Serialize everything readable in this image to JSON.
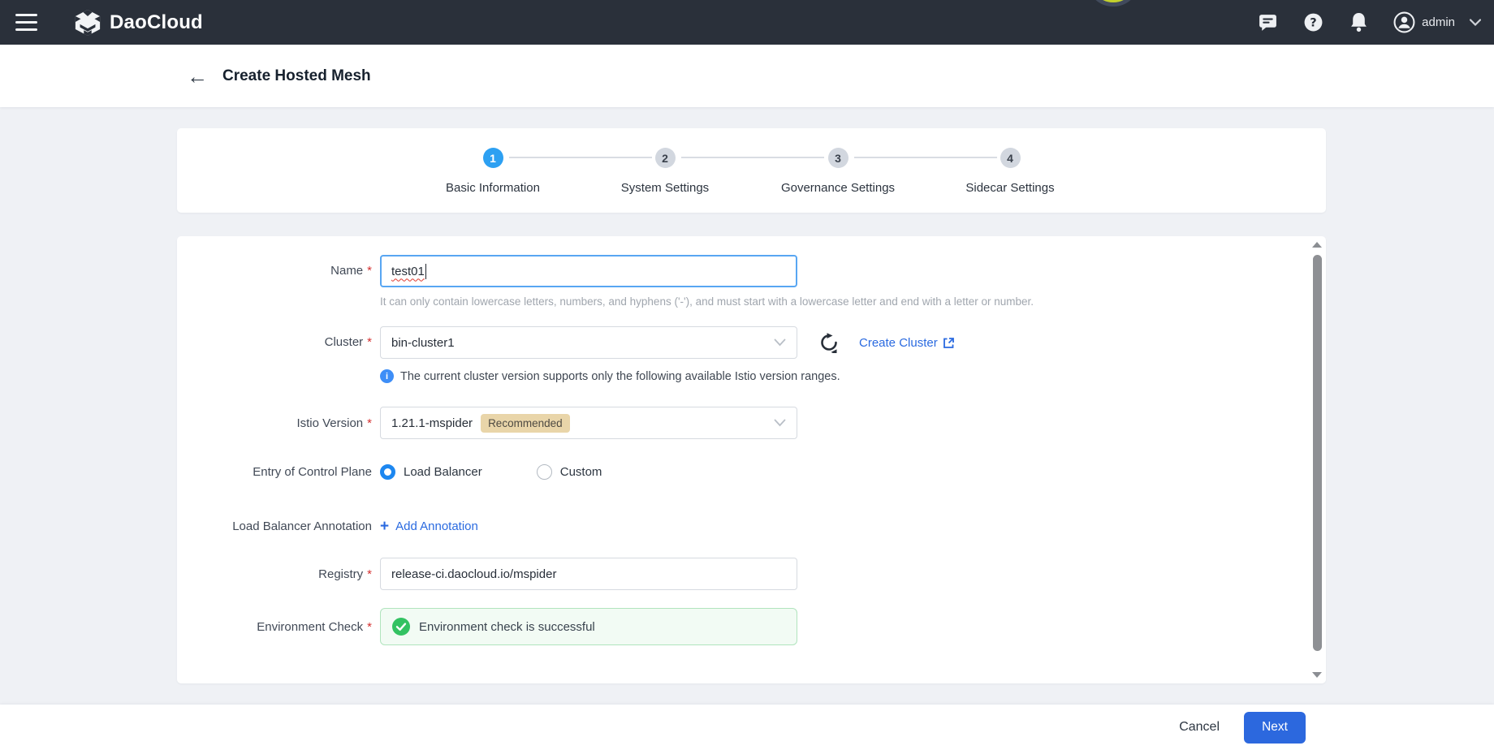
{
  "topbar": {
    "brand": "DaoCloud",
    "username": "admin"
  },
  "header": {
    "title": "Create Hosted Mesh"
  },
  "stepper": {
    "active_step": "1",
    "steps": [
      {
        "num": "1",
        "label": "Basic Information"
      },
      {
        "num": "2",
        "label": "System Settings"
      },
      {
        "num": "3",
        "label": "Governance Settings"
      },
      {
        "num": "4",
        "label": "Sidecar Settings"
      }
    ]
  },
  "form": {
    "name": {
      "label": "Name",
      "value": "test01",
      "helper": "It can only contain lowercase letters, numbers, and hyphens ('-'), and must start with a lowercase letter and end with a letter or number."
    },
    "cluster": {
      "label": "Cluster",
      "value": "bin-cluster1",
      "create_link": "Create Cluster",
      "info": "The current cluster version supports only the following available Istio version ranges."
    },
    "istio_version": {
      "label": "Istio Version",
      "value": "1.21.1-mspider",
      "badge": "Recommended"
    },
    "entry_of_control_plane": {
      "label": "Entry of Control Plane",
      "options": [
        "Load Balancer",
        "Custom"
      ],
      "selected": "Load Balancer"
    },
    "lb_annotation": {
      "label": "Load Balancer Annotation",
      "add_label": "Add Annotation"
    },
    "registry": {
      "label": "Registry",
      "value": "release-ci.daocloud.io/mspider"
    },
    "environment_check": {
      "label": "Environment Check",
      "message": "Environment check is successful"
    }
  },
  "footer": {
    "cancel_label": "Cancel",
    "next_label": "Next"
  },
  "colors": {
    "topbar_bg": "#2a303a",
    "accent_blue": "#2a6ae0",
    "step_active_blue": "#2da0f2",
    "radio_blue": "#1d87f0",
    "success_green": "#33c262",
    "badge_bg": "#e9d5a9",
    "required_red": "#d43030"
  }
}
